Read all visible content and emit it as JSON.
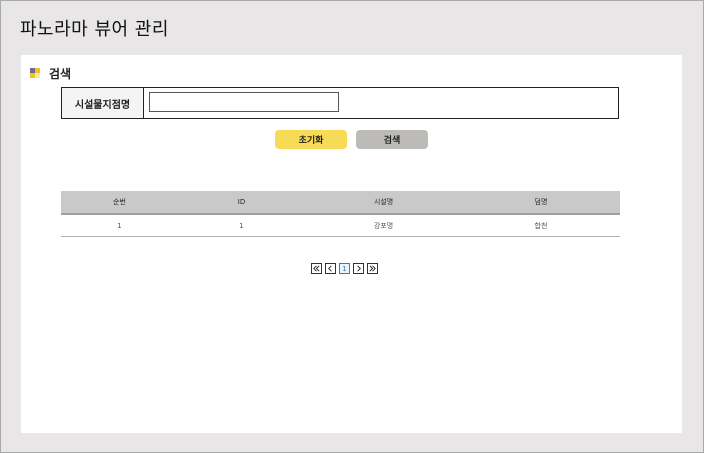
{
  "page": {
    "title": "파노라마 뷰어 관리"
  },
  "search": {
    "section_title": "검색",
    "field_label": "시설물지점명",
    "field_value": "",
    "field_placeholder": "",
    "reset_label": "초기화",
    "search_label": "검색"
  },
  "table": {
    "columns": [
      "순번",
      "ID",
      "시설명",
      "덤명"
    ],
    "rows": [
      [
        "1",
        "1",
        "강포명",
        "합천"
      ]
    ]
  },
  "pagination": {
    "first_icon": "double-chevron-left-icon",
    "prev_icon": "chevron-left-icon",
    "current_page": "1",
    "next_icon": "chevron-right-icon",
    "last_icon": "double-chevron-right-icon"
  },
  "colors": {
    "background": "#e8e6e7",
    "reset_button": "#f7da55",
    "search_button": "#bdbbb8",
    "table_header": "#c9c9c9"
  }
}
